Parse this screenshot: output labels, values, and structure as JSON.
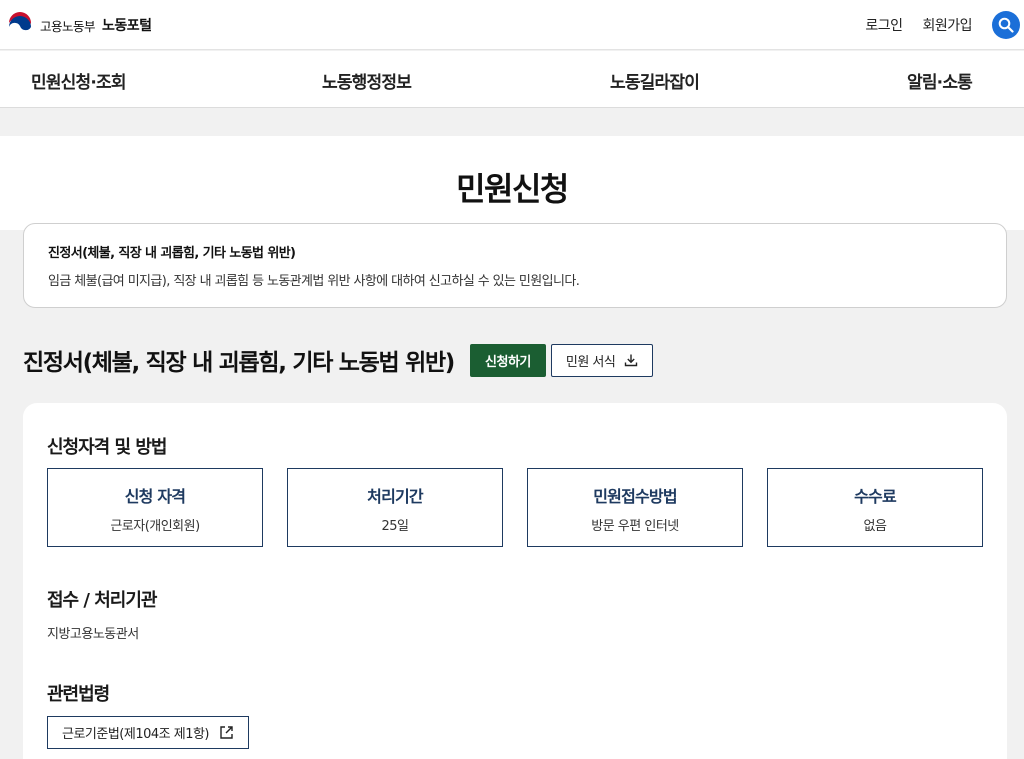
{
  "header": {
    "ministry": "고용노동부",
    "portal": "노동포털",
    "login": "로그인",
    "signup": "회원가입",
    "search_icon": "search-icon",
    "accent_color": "#1b6fd8"
  },
  "nav": {
    "items": [
      {
        "label": "민원신청·조회"
      },
      {
        "label": "노동행정정보"
      },
      {
        "label": "노동길라잡이"
      },
      {
        "label": "알림·소통"
      }
    ]
  },
  "page": {
    "title": "민원신청"
  },
  "notice": {
    "title": "진정서(체불, 직장 내 괴롭힘, 기타 노동법 위반)",
    "description": "임금 체불(급여 미지급), 직장 내 괴롭힘 등 노동관계법 위반 사항에 대하여 신고하실 수 있는 민원입니다."
  },
  "service": {
    "title": "진정서(체불, 직장 내 괴롭힘, 기타 노동법 위반)",
    "apply_label": "신청하기",
    "form_label": "민원 서식",
    "apply_color": "#1b5e32"
  },
  "details": {
    "qualification_heading": "신청자격 및 방법",
    "boxes": [
      {
        "label": "신청 자격",
        "value": "근로자(개인회원)"
      },
      {
        "label": "처리기간",
        "value": "25일"
      },
      {
        "label": "민원접수방법",
        "value": "방문 우편 인터넷"
      },
      {
        "label": "수수료",
        "value": "없음"
      }
    ],
    "agency_heading": "접수 / 처리기관",
    "agency": "지방고용노동관서",
    "law_heading": "관련법령",
    "law_link": "근로기준법(제104조 제1항)"
  }
}
